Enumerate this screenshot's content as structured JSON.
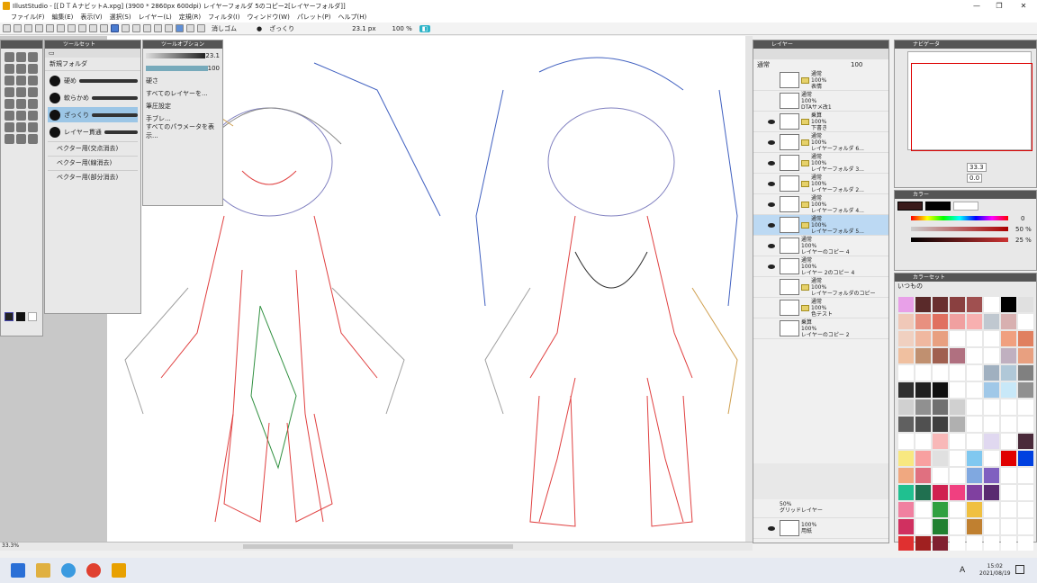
{
  "title": "IllustStudio - [[ＤＴＡナビットA.xpg] (3900 * 2860px 600dpi)  レイヤーフォルダ 5のコピー2[レイヤーフォルダ]]",
  "menu": [
    "ファイル(F)",
    "編集(E)",
    "表示(V)",
    "選択(S)",
    "レイヤー(L)",
    "定規(R)",
    "フィルタ(I)",
    "ウィンドウ(W)",
    "パレット(P)",
    "ヘルプ(H)"
  ],
  "toolbar": {
    "eraser": "消しゴム",
    "brush": "ざっくり",
    "size": "23.1 px",
    "zoom": "100 %"
  },
  "toolset": {
    "title": "ツールセット",
    "folder": "新規フォルダ",
    "brushes": [
      "硬め",
      "軟らかめ",
      "ざっくり",
      "レイヤー貫通"
    ],
    "vectors": [
      "ベクター用(交点消去)",
      "ベクター用(線消去)",
      "ベクター用(部分消去)"
    ]
  },
  "tooloption": {
    "title": "ツールオプション",
    "size": "23.1",
    "density": "100",
    "hardness": "硬さ",
    "all_layers": "すべてのレイヤーを...",
    "pressure": "筆圧設定",
    "blur": "手ブレ...",
    "params": "すべてのパラメータを表示..."
  },
  "layers": {
    "title": "レイヤー",
    "blend": "通常",
    "opacity": "100",
    "rows": [
      {
        "mode": "通常",
        "op": "100%",
        "name": "表情",
        "eye": false,
        "folder": true
      },
      {
        "mode": "通常",
        "op": "100%",
        "name": "DTAサメ改1",
        "eye": false,
        "folder": false
      },
      {
        "mode": "乗算",
        "op": "100%",
        "name": "下書き",
        "eye": true,
        "folder": true
      },
      {
        "mode": "通常",
        "op": "100%",
        "name": "レイヤーフォルダ 6...",
        "eye": true,
        "folder": true
      },
      {
        "mode": "通常",
        "op": "100%",
        "name": "レイヤーフォルダ 3...",
        "eye": true,
        "folder": true
      },
      {
        "mode": "通常",
        "op": "100%",
        "name": "レイヤーフォルダ 2...",
        "eye": true,
        "folder": true
      },
      {
        "mode": "通常",
        "op": "100%",
        "name": "レイヤーフォルダ 4...",
        "eye": true,
        "folder": true
      },
      {
        "mode": "通常",
        "op": "100%",
        "name": "レイヤーフォルダ 5...",
        "eye": true,
        "folder": true
      },
      {
        "mode": "通常",
        "op": "100%",
        "name": "レイヤーのコピー 4",
        "eye": true,
        "folder": false
      },
      {
        "mode": "通常",
        "op": "100%",
        "name": "レイヤー 2のコピー 4",
        "eye": true,
        "folder": false
      },
      {
        "mode": "通常",
        "op": "100%",
        "name": "レイヤーフォルダのコピー",
        "eye": false,
        "folder": true
      },
      {
        "mode": "通常",
        "op": "100%",
        "name": "色テスト",
        "eye": false,
        "folder": true
      },
      {
        "mode": "乗算",
        "op": "100%",
        "name": "レイヤーのコピー 2",
        "eye": false,
        "folder": false
      }
    ],
    "grid": {
      "op": "50%",
      "name": "グリッドレイヤー"
    },
    "paper": {
      "op": "100%",
      "name": "用紙"
    }
  },
  "navigator": {
    "title": "ナビゲータ",
    "zoom": "33.3",
    "angle": "0.0"
  },
  "color": {
    "title": "カラー",
    "s": "50 %",
    "v": "25 %",
    "h": "0"
  },
  "colorset": {
    "title": "カラーセット",
    "name": "いつもの"
  },
  "status": {
    "zoom": "33.3%"
  },
  "taskbar": {
    "time": "15:02",
    "date": "2021/08/19",
    "ime": "A"
  },
  "swatch_colors": [
    "#e8a0e8",
    "#5a2a2a",
    "#6a3030",
    "#8a4040",
    "#a05050",
    "#ffffff",
    "#000000",
    "#e0e0e0",
    "#f0c8b8",
    "#e89080",
    "#e07060",
    "#f0a0a0",
    "#f8b0b0",
    "#c0c8d0",
    "#d8b0b0",
    "#ffffff",
    "#f0d0c0",
    "#f0b8a0",
    "#e8a080",
    "#ffffff",
    "#ffffff",
    "#ffffff",
    "#f0a080",
    "#e08060",
    "#f0c0a0",
    "#c09070",
    "#a06050",
    "#b07080",
    "#ffffff",
    "#ffffff",
    "#c0b0c0",
    "#e8a080",
    "#ffffff",
    "#ffffff",
    "#ffffff",
    "#ffffff",
    "#ffffff",
    "#a0b0c0",
    "#b0c8d8",
    "#808080",
    "#303030",
    "#202020",
    "#101010",
    "#ffffff",
    "#ffffff",
    "#a0c8e8",
    "#c8e8f8",
    "#909090",
    "#d0d0d0",
    "#909090",
    "#707070",
    "#d0d0d0",
    "#ffffff",
    "#ffffff",
    "#ffffff",
    "#ffffff",
    "#606060",
    "#505050",
    "#404040",
    "#b0b0b0",
    "#ffffff",
    "#ffffff",
    "#ffffff",
    "#ffffff",
    "#ffffff",
    "#ffffff",
    "#f8b8b8",
    "#ffffff",
    "#ffffff",
    "#e0d8f0",
    "#ffffff",
    "#4a2a3a",
    "#f8e880",
    "#f8a0a0",
    "#e0e0e0",
    "#ffffff",
    "#80c8f0",
    "#ffffff",
    "#e00000",
    "#0040e0",
    "#f0a880",
    "#e07080",
    "#ffffff",
    "#ffffff",
    "#80a8e0",
    "#8060c0",
    "#ffffff",
    "#ffffff",
    "#20c090",
    "#207050",
    "#d02050",
    "#f04080",
    "#8040a0",
    "#5a2a70",
    "#ffffff",
    "#ffffff",
    "#f080a0",
    "#ffffff",
    "#30a040",
    "#ffffff",
    "#f0c040",
    "#ffffff",
    "#ffffff",
    "#ffffff",
    "#d03060",
    "#ffffff",
    "#208030",
    "#ffffff",
    "#c08030",
    "#ffffff",
    "#ffffff",
    "#ffffff",
    "#e03030",
    "#a02020",
    "#802030",
    "#ffffff",
    "#ffffff",
    "#ffffff",
    "#ffffff",
    "#ffffff",
    "#f0c8c0",
    "#e0a090",
    "#c08070",
    "#ffffff",
    "#f0c8b8",
    "#ffffff",
    "#ffffff",
    "#ffffff"
  ]
}
